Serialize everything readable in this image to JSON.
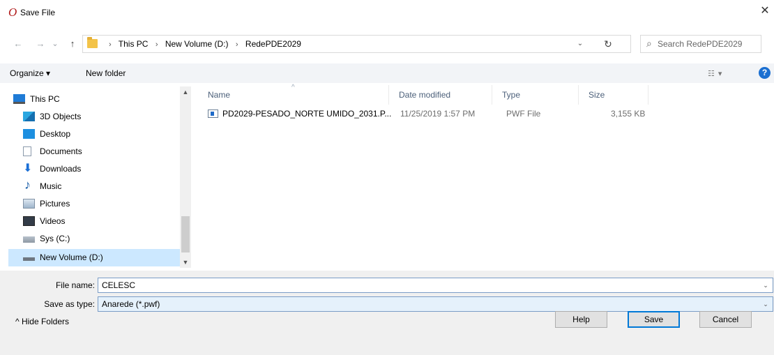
{
  "window": {
    "title": "Save File",
    "app_icon_glyph": "O",
    "close_glyph": "✕"
  },
  "nav": {
    "back_glyph": "←",
    "forward_glyph": "→",
    "recent_glyph": "⌄",
    "up_glyph": "↑",
    "breadcrumb": [
      "This PC",
      "New Volume (D:)",
      "RedePDE2029"
    ],
    "separator": "›",
    "dropdown_glyph": "⌄",
    "refresh_glyph": "↻",
    "search_placeholder": "Search RedePDE2029"
  },
  "toolbar": {
    "organize": "Organize ▾",
    "new_folder": "New folder",
    "view_glyph": "☷ ▾",
    "help_glyph": "?"
  },
  "sidebar": {
    "items": [
      {
        "label": "This PC",
        "icon": "computer-icon"
      },
      {
        "label": "3D Objects",
        "icon": "3d-objects-icon"
      },
      {
        "label": "Desktop",
        "icon": "desktop-icon"
      },
      {
        "label": "Documents",
        "icon": "documents-icon"
      },
      {
        "label": "Downloads",
        "icon": "downloads-icon"
      },
      {
        "label": "Music",
        "icon": "music-icon"
      },
      {
        "label": "Pictures",
        "icon": "pictures-icon"
      },
      {
        "label": "Videos",
        "icon": "videos-icon"
      },
      {
        "label": "Sys (C:)",
        "icon": "drive-icon"
      },
      {
        "label": "New Volume (D:)",
        "icon": "drive-icon"
      }
    ]
  },
  "columns": {
    "name": "Name",
    "date": "Date modified",
    "type": "Type",
    "size": "Size",
    "sort_glyph": "^"
  },
  "files": [
    {
      "name": "PD2029-PESADO_NORTE UMIDO_2031.P...",
      "date": "11/25/2019 1:57 PM",
      "type": "PWF File",
      "size": "3,155 KB"
    }
  ],
  "form": {
    "file_name_label": "File name:",
    "file_name_value": "CELESC",
    "save_type_label": "Save as type:",
    "save_type_value": "Anarede (*.pwf)",
    "dropdown_glyph": "⌄"
  },
  "footer": {
    "hide_folders": "^ Hide Folders",
    "help": "Help",
    "save": "Save",
    "cancel": "Cancel"
  },
  "colors": {
    "accent": "#0078d7",
    "selection": "#cce8ff",
    "toolbar_bg": "#f2f4f7"
  }
}
